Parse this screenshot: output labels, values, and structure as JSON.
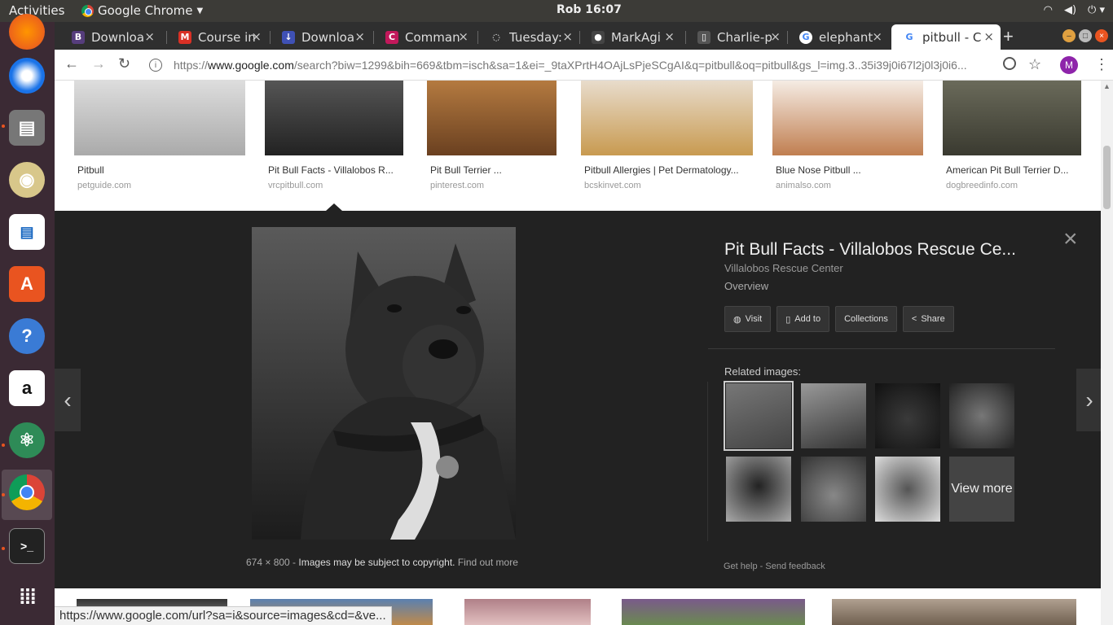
{
  "system": {
    "activities": "Activities",
    "app_name": "Google Chrome",
    "clock": "Rob 16:07"
  },
  "launcher": [
    "firefox-icon",
    "thunderbird-icon",
    "files-icon",
    "rhythmbox-icon",
    "writer-icon",
    "software-center-icon",
    "help-icon",
    "amazon-icon",
    "atom-icon",
    "chrome-icon",
    "terminal-icon",
    "app-grid-icon"
  ],
  "tabs": [
    {
      "title": "Downloa",
      "favicon": "bootstrap-icon",
      "color": "#563d7c",
      "glyph": "B"
    },
    {
      "title": "Course in",
      "favicon": "gmail-icon",
      "color": "#d93025",
      "glyph": "M"
    },
    {
      "title": "Downloa",
      "favicon": "download-icon",
      "color": "#3f51b5",
      "glyph": "↓"
    },
    {
      "title": "Comman",
      "favicon": "command-icon",
      "color": "#c2185b",
      "glyph": "C"
    },
    {
      "title": "Tuesday:",
      "favicon": "loading-icon",
      "color": "#2f2f2f",
      "glyph": "◌"
    },
    {
      "title": "MarkAgi",
      "favicon": "github-icon",
      "color": "#444",
      "glyph": "●"
    },
    {
      "title": "Charlie-p",
      "favicon": "page-icon",
      "color": "#555",
      "glyph": "▯"
    },
    {
      "title": "elephant",
      "favicon": "google-icon",
      "color": "#fff",
      "glyph": "G"
    },
    {
      "title": "pitbull - C",
      "favicon": "google-icon",
      "color": "#fff",
      "glyph": "G",
      "active": true
    }
  ],
  "address": {
    "prefix": "https://",
    "host": "www.google.com",
    "rest": "/search?biw=1299&bih=669&tbm=isch&sa=1&ei=_9taXPrtH4OAjLsPjeSCgAI&q=pitbull&oq=pitbull&gs_l=img.3..35i39j0i67l2j0l3j0i6..."
  },
  "results_top": [
    {
      "title": "Pitbull",
      "source": "petguide.com"
    },
    {
      "title": "Pit Bull Facts - Villalobos R...",
      "source": "vrcpitbull.com"
    },
    {
      "title": "Pit Bull Terrier ...",
      "source": "pinterest.com"
    },
    {
      "title": "Pitbull Allergies | Pet Dermatology...",
      "source": "bcskinvet.com"
    },
    {
      "title": "Blue Nose Pitbull ...",
      "source": "animalso.com"
    },
    {
      "title": "American Pit Bull Terrier D...",
      "source": "dogbreedinfo.com"
    }
  ],
  "preview": {
    "title": "Pit Bull Facts - Villalobos Rescue Ce...",
    "site": "Villalobos Rescue Center",
    "overview": "Overview",
    "actions": [
      {
        "label": "Visit",
        "icon": "globe-icon",
        "glyph": "🌐"
      },
      {
        "label": "Add to",
        "icon": "bookmark-icon",
        "glyph": "▯"
      },
      {
        "label": "Collections",
        "icon": "",
        "glyph": ""
      },
      {
        "label": "Share",
        "icon": "share-icon",
        "glyph": "<"
      }
    ],
    "related_label": "Related images:",
    "view_more": "View more",
    "dims": "674 × 800",
    "dims_sep": " - ",
    "copyright": "Images may be subject to copyright.",
    "find_out_more": "Find out more",
    "get_help": "Get help",
    "footer_sep": " - ",
    "send_feedback": "Send feedback"
  },
  "status_url": "https://www.google.com/url?sa=i&source=images&cd=&ve..."
}
